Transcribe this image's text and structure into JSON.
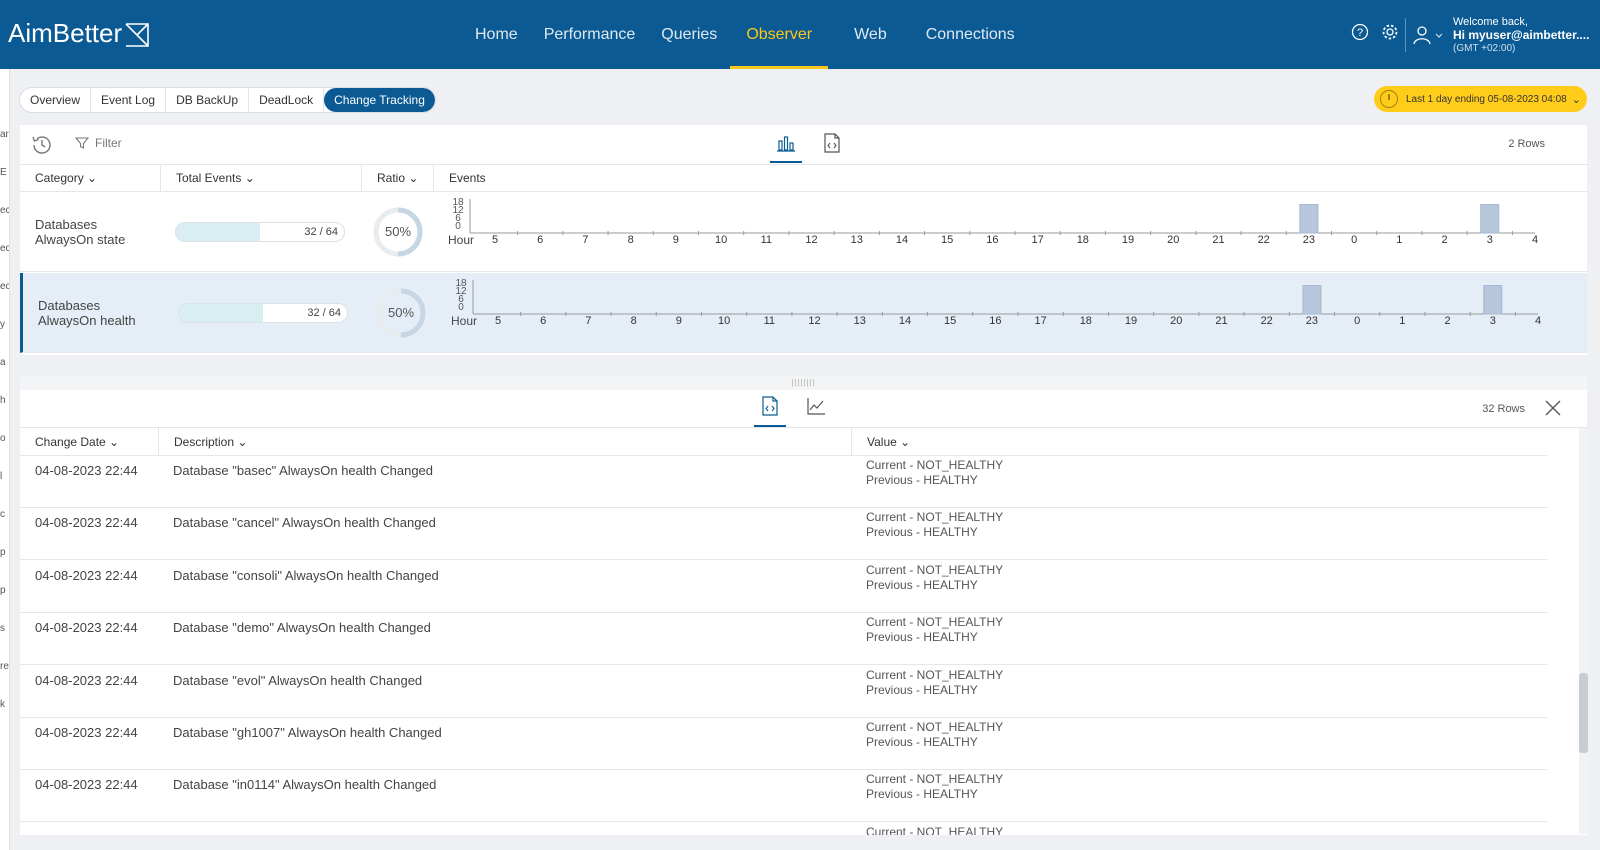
{
  "app": {
    "logo_text": "AimBetter",
    "nav": [
      "Home",
      "Performance",
      "Queries",
      "Observer",
      "Web",
      "Connections"
    ],
    "nav_active": "Observer",
    "user": {
      "welcome": "Welcome back,",
      "name": "Hi myuser@aimbetter....",
      "timezone": "(GMT +02:00)"
    },
    "colors": {
      "header": "#0b5a93",
      "accent": "#ffc61a"
    }
  },
  "subtabs": [
    "Overview",
    "Event Log",
    "DB BackUp",
    "DeadLock",
    "Change Tracking"
  ],
  "subtab_active": "Change Tracking",
  "time_range": {
    "label": "Last 1 day ending",
    "date": "05-08-2023 04:08"
  },
  "upper": {
    "filter_placeholder": "Filter",
    "rows_count": "2 Rows",
    "columns": [
      "Category",
      "Total Events",
      "Ratio",
      "Events"
    ],
    "hours": [
      "5",
      "6",
      "7",
      "8",
      "9",
      "10",
      "11",
      "12",
      "13",
      "14",
      "15",
      "16",
      "17",
      "18",
      "19",
      "20",
      "21",
      "22",
      "23",
      "0",
      "1",
      "2",
      "3",
      "4"
    ],
    "y_ticks": [
      "18",
      "12",
      "6",
      "0"
    ],
    "hour_label": "Hour",
    "rows": [
      {
        "line1": "Databases",
        "line2": "AlwaysOn state",
        "events_text": "32 / 64",
        "fill_ratio": 0.5,
        "ratio": "50%",
        "bars": {
          "23": 16,
          "3": 16
        }
      },
      {
        "line1": "Databases",
        "line2": "AlwaysOn health",
        "events_text": "32 / 64",
        "fill_ratio": 0.5,
        "ratio": "50%",
        "bars": {
          "23": 16,
          "3": 16
        }
      }
    ]
  },
  "lower": {
    "rows_count": "32 Rows",
    "columns": [
      "Change Date",
      "Description",
      "Value"
    ],
    "rows": [
      {
        "date": "04-08-2023 22:44",
        "desc": "Database \"basec\" AlwaysOn health Changed",
        "current": "Current - NOT_HEALTHY",
        "previous": "Previous - HEALTHY"
      },
      {
        "date": "04-08-2023 22:44",
        "desc": "Database \"cancel\" AlwaysOn health Changed",
        "current": "Current - NOT_HEALTHY",
        "previous": "Previous - HEALTHY"
      },
      {
        "date": "04-08-2023 22:44",
        "desc": "Database \"consoli\" AlwaysOn health Changed",
        "current": "Current - NOT_HEALTHY",
        "previous": "Previous - HEALTHY"
      },
      {
        "date": "04-08-2023 22:44",
        "desc": "Database \"demo\" AlwaysOn health Changed",
        "current": "Current - NOT_HEALTHY",
        "previous": "Previous - HEALTHY"
      },
      {
        "date": "04-08-2023 22:44",
        "desc": "Database \"evol\" AlwaysOn health Changed",
        "current": "Current - NOT_HEALTHY",
        "previous": "Previous - HEALTHY"
      },
      {
        "date": "04-08-2023 22:44",
        "desc": "Database \"gh1007\" AlwaysOn health Changed",
        "current": "Current - NOT_HEALTHY",
        "previous": "Previous - HEALTHY"
      },
      {
        "date": "04-08-2023 22:44",
        "desc": "Database \"in0114\" AlwaysOn health Changed",
        "current": "Current - NOT_HEALTHY",
        "previous": "Previous - HEALTHY"
      },
      {
        "date": "",
        "desc": "",
        "current": "Current - NOT_HEALTHY",
        "previous": ""
      }
    ]
  },
  "left_strip_letters": [
    "ar",
    "E",
    "ec",
    "ec",
    "ec",
    "y",
    "a",
    "h",
    "o",
    "l",
    "c",
    "p",
    "p",
    "s",
    "re",
    "k"
  ]
}
